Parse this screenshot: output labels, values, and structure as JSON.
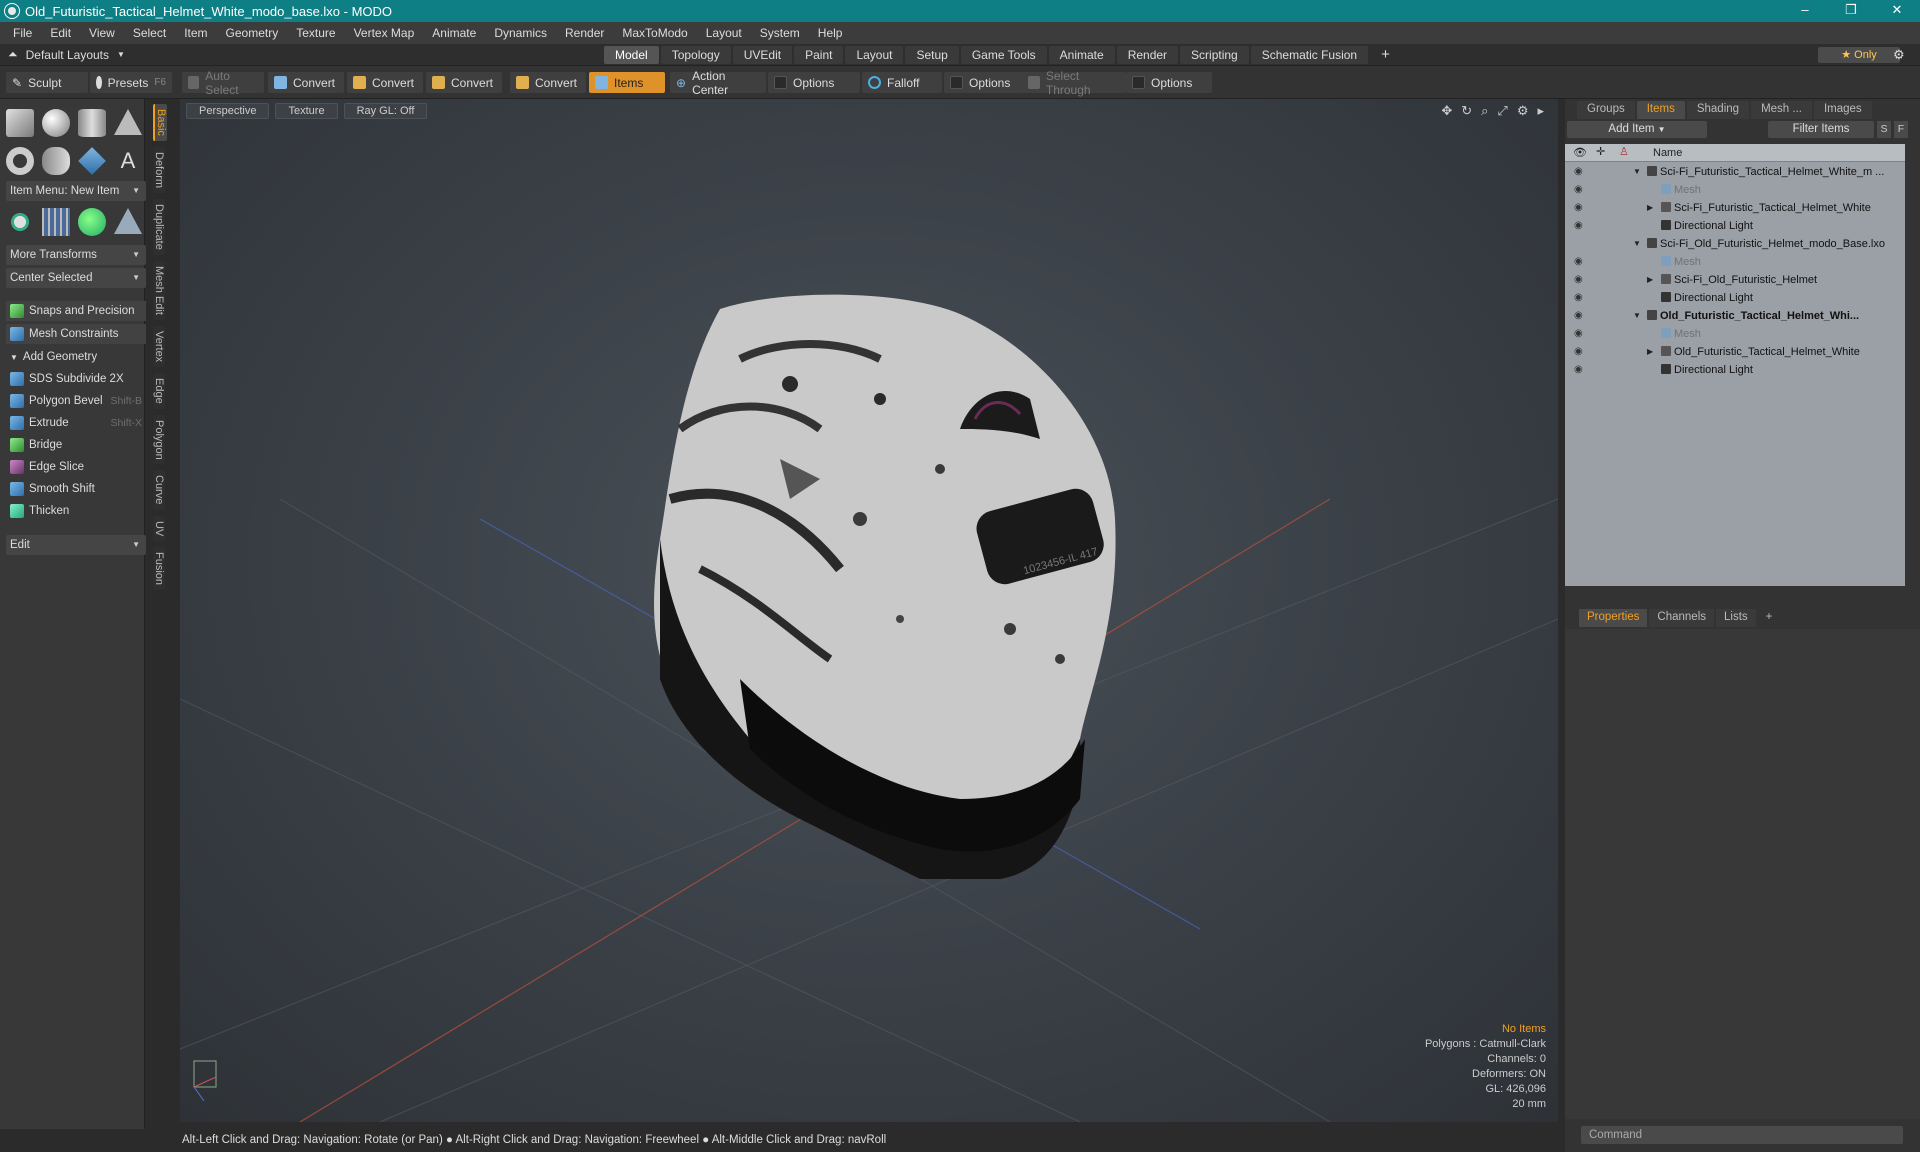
{
  "window": {
    "title": "Old_Futuristic_Tactical_Helmet_White_modo_base.lxo - MODO",
    "controls": [
      "–",
      "❐",
      "✕"
    ]
  },
  "menu": [
    "File",
    "Edit",
    "View",
    "Select",
    "Item",
    "Geometry",
    "Texture",
    "Vertex Map",
    "Animate",
    "Dynamics",
    "Render",
    "MaxToModo",
    "Layout",
    "System",
    "Help"
  ],
  "layoutbar": {
    "dropdown": "Default Layouts",
    "tabs": [
      "Model",
      "Topology",
      "UVEdit",
      "Paint",
      "Layout",
      "Setup",
      "Game Tools",
      "Animate",
      "Render",
      "Scripting",
      "Schematic Fusion"
    ],
    "active_tab": "Model",
    "only_label": "Only"
  },
  "toolbar": {
    "sculpt": "Sculpt",
    "presets": "Presets",
    "presets_key": "F6",
    "auto_select": "Auto Select",
    "convert1": "Convert",
    "convert2": "Convert",
    "convert3": "Convert",
    "convert4": "Convert",
    "items": "Items",
    "action_center": "Action Center",
    "options1": "Options",
    "falloff": "Falloff",
    "options2": "Options",
    "select_through": "Select Through",
    "options3": "Options"
  },
  "left": {
    "vtabs": [
      "Basic",
      "Deform",
      "Duplicate",
      "Mesh Edit",
      "Vertex",
      "Edge",
      "Polygon",
      "Curve",
      "UV",
      "Fusion"
    ],
    "item_menu": "Item Menu: New Item",
    "more_transforms": "More Transforms",
    "center_selected": "Center Selected",
    "snaps": "Snaps and Precision",
    "mesh_constraints": "Mesh Constraints",
    "add_geometry": "Add Geometry",
    "tools": [
      {
        "label": "SDS Subdivide 2X",
        "key": ""
      },
      {
        "label": "Polygon Bevel",
        "key": "Shift-B"
      },
      {
        "label": "Extrude",
        "key": "Shift-X"
      },
      {
        "label": "Bridge",
        "key": ""
      },
      {
        "label": "Edge Slice",
        "key": ""
      },
      {
        "label": "Smooth Shift",
        "key": ""
      },
      {
        "label": "Thicken",
        "key": ""
      }
    ],
    "edit": "Edit"
  },
  "viewport": {
    "view": "Perspective",
    "shading": "Texture",
    "raygl": "Ray GL: Off",
    "plate_text": "1023456-IL 417",
    "stats": {
      "no_items": "No Items",
      "polygons": "Polygons : Catmull-Clark",
      "channels": "Channels: 0",
      "deformers": "Deformers: ON",
      "gl": "GL: 426,096",
      "scale": "20 mm"
    }
  },
  "status": "Alt-Left Click and Drag: Navigation: Rotate (or Pan) ● Alt-Right Click and Drag: Navigation: Freewheel ● Alt-Middle Click and Drag: navRoll",
  "right": {
    "tabs": [
      "Groups",
      "Items",
      "Shading",
      "Mesh ...",
      "Images"
    ],
    "active_tab": "Items",
    "add_item": "Add Item",
    "filter": "Filter Items",
    "s_btn": "S",
    "f_btn": "F",
    "col_name": "Name",
    "tree": [
      {
        "label": "Sci-Fi_Futuristic_Tactical_Helmet_White_m ...",
        "level": 0,
        "expanded": true,
        "kind": "scene",
        "bold": false,
        "dim": false,
        "eye": true
      },
      {
        "label": "Mesh",
        "level": 1,
        "expanded": false,
        "kind": "mesh",
        "bold": false,
        "dim": true,
        "eye": true
      },
      {
        "label": "Sci-Fi_Futuristic_Tactical_Helmet_White",
        "level": 1,
        "expanded": false,
        "kind": "group",
        "bold": false,
        "dim": false,
        "eye": true,
        "collapsed": true
      },
      {
        "label": "Directional Light",
        "level": 1,
        "expanded": false,
        "kind": "light",
        "bold": false,
        "dim": false,
        "eye": true
      },
      {
        "label": "Sci-Fi_Old_Futuristic_Helmet_modo_Base.lxo",
        "level": 0,
        "expanded": true,
        "kind": "scene",
        "bold": false,
        "dim": false,
        "eye": false
      },
      {
        "label": "Mesh",
        "level": 1,
        "expanded": false,
        "kind": "mesh",
        "bold": false,
        "dim": true,
        "eye": true
      },
      {
        "label": "Sci-Fi_Old_Futuristic_Helmet",
        "level": 1,
        "expanded": false,
        "kind": "group",
        "bold": false,
        "dim": false,
        "eye": true,
        "collapsed": true
      },
      {
        "label": "Directional Light",
        "level": 1,
        "expanded": false,
        "kind": "light",
        "bold": false,
        "dim": false,
        "eye": true
      },
      {
        "label": "Old_Futuristic_Tactical_Helmet_Whi...",
        "level": 0,
        "expanded": true,
        "kind": "scene",
        "bold": true,
        "dim": false,
        "eye": true
      },
      {
        "label": "Mesh",
        "level": 1,
        "expanded": false,
        "kind": "mesh",
        "bold": false,
        "dim": true,
        "eye": true
      },
      {
        "label": "Old_Futuristic_Tactical_Helmet_White",
        "level": 1,
        "expanded": false,
        "kind": "group",
        "bold": false,
        "dim": false,
        "eye": true,
        "collapsed": true
      },
      {
        "label": "Directional Light",
        "level": 1,
        "expanded": false,
        "kind": "light",
        "bold": false,
        "dim": false,
        "eye": true
      }
    ],
    "prop_tabs": [
      "Properties",
      "Channels",
      "Lists"
    ],
    "prop_active": "Properties",
    "command": "Command"
  }
}
